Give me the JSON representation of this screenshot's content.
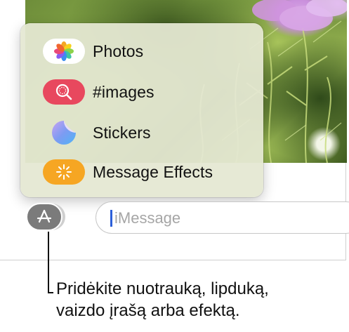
{
  "apps_menu": {
    "items": [
      {
        "label": "Photos",
        "icon": "photos-icon"
      },
      {
        "label": "#images",
        "icon": "images-search-icon"
      },
      {
        "label": "Stickers",
        "icon": "stickers-icon"
      },
      {
        "label": "Message Effects",
        "icon": "message-effects-icon"
      }
    ]
  },
  "composer": {
    "apps_button_icon": "app-store-icon",
    "placeholder": "iMessage"
  },
  "callout": {
    "line1": "Pridėkite nuotrauką, lipduką,",
    "line2": "vaizdo įrašą arba efektą."
  },
  "colors": {
    "images_icon_bg": "#e8485e",
    "effects_icon_bg": "#f6a623",
    "caret": "#2c5fd9",
    "apps_button_bg": "#7b7b7b"
  }
}
